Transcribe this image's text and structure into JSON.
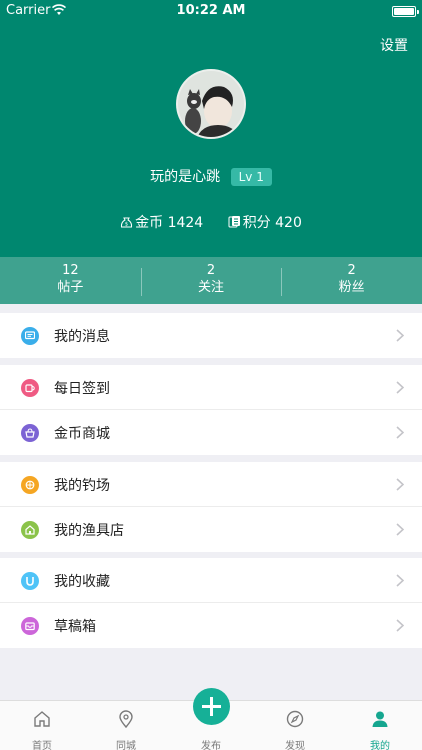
{
  "status_bar": {
    "carrier": "Carrier",
    "time": "10:22 AM"
  },
  "header": {
    "settings_label": "设置",
    "username": "玩的是心跳",
    "level": "Lv 1",
    "coins_label": "金币 1424",
    "points_label": "积分 420"
  },
  "stats": [
    {
      "value": "12",
      "label": "帖子"
    },
    {
      "value": "2",
      "label": "关注"
    },
    {
      "value": "2",
      "label": "粉丝"
    }
  ],
  "menu": {
    "messages": "我的消息",
    "checkin": "每日签到",
    "coin_mall": "金币商城",
    "my_spot": "我的钓场",
    "tackle_shop": "我的渔具店",
    "favorites": "我的收藏",
    "drafts": "草稿箱"
  },
  "icon_colors": {
    "messages": "#3aaeea",
    "checkin": "#ef5a83",
    "coin_mall": "#7c63d4",
    "my_spot": "#f5a623",
    "tackle_shop": "#8bc34a",
    "favorites": "#4fc3f7",
    "drafts": "#cc66d9"
  },
  "tabbar": {
    "home": "首页",
    "local": "同城",
    "post": "发布",
    "discover": "发现",
    "mine": "我的"
  },
  "colors": {
    "header": "#00876f",
    "accent": "#15a68f"
  }
}
